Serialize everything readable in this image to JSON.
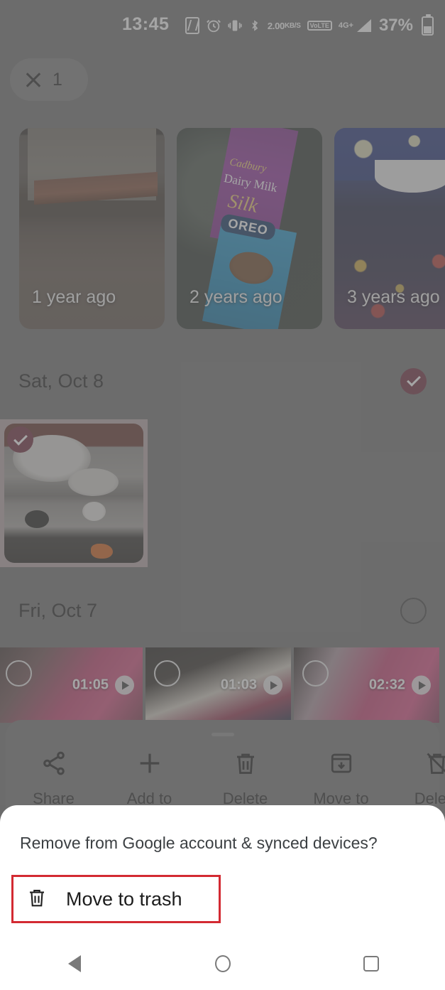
{
  "status_bar": {
    "time": "13:45",
    "battery_percent": "37%",
    "data_rate": "2.00",
    "data_rate_unit": "KB/S",
    "volte_top": "Vo",
    "volte_bottom": "LTE",
    "network": "4G+",
    "icons": [
      "nfc-icon",
      "alarm-icon",
      "vibrate-icon",
      "bluetooth-icon",
      "data-rate-icon",
      "volte-icon",
      "signal-icon",
      "battery-icon"
    ]
  },
  "selection_chip": {
    "close_label": "✕",
    "count": "1"
  },
  "memories": [
    {
      "label": "1 year ago",
      "kind": "photo-old-house"
    },
    {
      "label": "2 years ago",
      "kind": "photo-chocolate-bar",
      "brand": "Cadbury",
      "product": "Dairy Milk",
      "variant": "Silk",
      "flavor": "OREO"
    },
    {
      "label": "3 years ago",
      "kind": "photo-clothing"
    }
  ],
  "sections": [
    {
      "date": "Sat, Oct 8",
      "selected": true,
      "select_state": "checked"
    },
    {
      "date": "Fri, Oct 7",
      "selected": false,
      "select_state": "unchecked"
    }
  ],
  "photos": [
    {
      "id": "stove-photo",
      "selected": true,
      "date_group": "Sat, Oct 8"
    }
  ],
  "videos": [
    {
      "duration": "01:05",
      "selected": false
    },
    {
      "duration": "01:03",
      "selected": false
    },
    {
      "duration": "02:32",
      "selected": false
    }
  ],
  "action_bar": [
    {
      "label": "Share",
      "icon": "share-icon"
    },
    {
      "label": "Add to",
      "icon": "plus-icon"
    },
    {
      "label": "Delete",
      "icon": "trash-icon"
    },
    {
      "label": "Move to",
      "icon": "archive-down-icon"
    },
    {
      "label": "Delete",
      "icon": "trash-off-icon"
    }
  ],
  "dialog": {
    "title": "Remove from Google account & synced devices?",
    "primary_action": {
      "label": "Move to trash",
      "icon": "trash-icon"
    }
  },
  "nav_bar": {
    "back": "back-button",
    "home": "home-button",
    "recents": "recents-button"
  },
  "colors": {
    "accent_selected": "#6b2236",
    "annotation_red": "#d32a32",
    "scrim": "#6e6e6e",
    "dialog_bg": "#ffffff",
    "dialog_title": "#3c4043"
  }
}
